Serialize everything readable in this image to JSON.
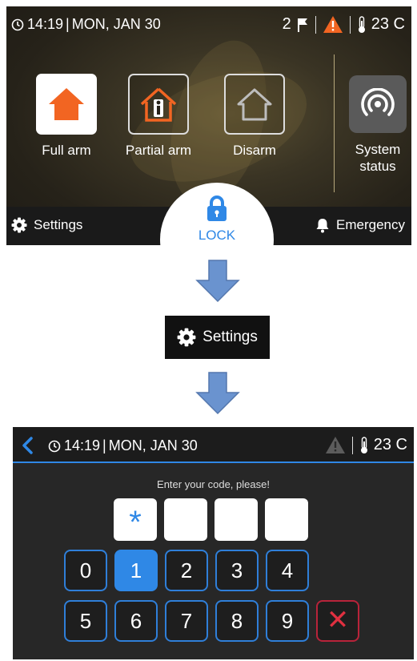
{
  "top_screen": {
    "status": {
      "time": "14:19",
      "separator": "|",
      "date": "MON, JAN 30",
      "alert_count": "2",
      "temperature": "23 C"
    },
    "arm_buttons": [
      {
        "label": "Full arm",
        "icon": "house-filled-icon"
      },
      {
        "label": "Partial arm",
        "icon": "house-person-icon"
      },
      {
        "label": "Disarm",
        "icon": "house-outline-icon"
      }
    ],
    "system_status": {
      "line1": "System",
      "line2": "status",
      "icon": "signal-icon"
    },
    "bottom_bar": {
      "settings_label": "Settings",
      "emergency_label": "Emergency",
      "lock_label": "LOCK"
    }
  },
  "callout": {
    "settings_label": "Settings"
  },
  "code_screen": {
    "status": {
      "time": "14:19",
      "separator": "|",
      "date": "MON, JAN 30",
      "temperature": "23 C"
    },
    "prompt": "Enter your code, please!",
    "code_boxes": [
      "*",
      "",
      "",
      ""
    ],
    "keypad_row1": [
      "0",
      "1",
      "2",
      "3",
      "4"
    ],
    "keypad_row2": [
      "5",
      "6",
      "7",
      "8",
      "9"
    ],
    "delete_symbol": "✕",
    "pressed_key": "1"
  },
  "colors": {
    "accent": "#2f88e6",
    "warning": "#f26522",
    "delete": "#b8233a",
    "bar": "#1a1a1a"
  }
}
